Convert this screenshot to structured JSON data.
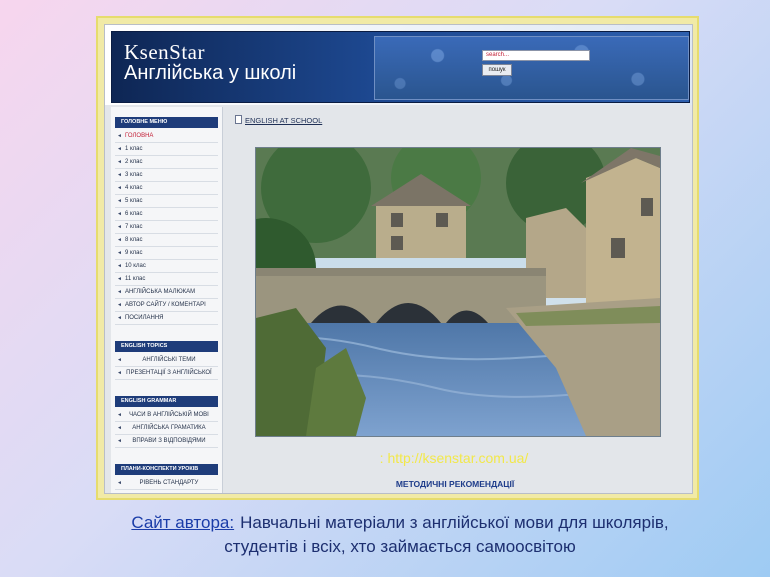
{
  "header": {
    "logo": "KsenStar",
    "subtitle": "Англійська у школі",
    "search_placeholder": "search...",
    "search_button": "пошук"
  },
  "sidebar": {
    "main_menu": {
      "title": "ГОЛОВНЕ МЕНЮ",
      "items": [
        "ГОЛОВНА",
        "1 клас",
        "2 клас",
        "3 клас",
        "4 клас",
        "5 клас",
        "6 клас",
        "7 клас",
        "8 клас",
        "9 клас",
        "10 клас",
        "11 клас",
        "АНГЛІЙСЬКА МАЛЮКАМ",
        "АВТОР САЙТУ / КОМЕНТАРІ",
        "ПОСИЛАННЯ"
      ]
    },
    "topics": {
      "title": "ENGLISH TOPICS",
      "items": [
        "АНГЛІЙСЬКІ ТЕМИ",
        "ПРЕЗЕНТАЦІЇ З АНГЛІЙСЬКОЇ"
      ]
    },
    "grammar": {
      "title": "ENGLISH GRAMMAR",
      "items": [
        "ЧАСИ В АНГЛІЙСЬКІЙ МОВІ",
        "АНГЛІЙСЬКА ГРАМАТИКА",
        "ВПРАВИ З ВІДПОВІДЯМИ"
      ]
    },
    "plans": {
      "title": "ПЛАНИ-КОНСПЕКТИ УРОКІВ",
      "items": [
        "РІВЕНЬ СТАНДАРТУ"
      ]
    }
  },
  "main": {
    "breadcrumb": "ENGLISH AT SCHOOL",
    "url": ": http://ksenstar.com.ua/",
    "methodical_link": "МЕТОДИЧНІ РЕКОМЕНДАЦІЇ"
  },
  "caption": {
    "label": "Сайт автора:",
    "text": "Навчальні матеріали з англійської мови для школярів, студентів і всіх, хто займається самоосвітою"
  },
  "colors": {
    "banner": "#1d4890",
    "menu_header": "#1e3c7a",
    "url_text": "#f2e84a",
    "frame": "#f1eaa6",
    "active_item": "#c21f36"
  },
  "icons": {
    "menu_arrow": "arrow-left-icon",
    "breadcrumb": "page-icon"
  }
}
